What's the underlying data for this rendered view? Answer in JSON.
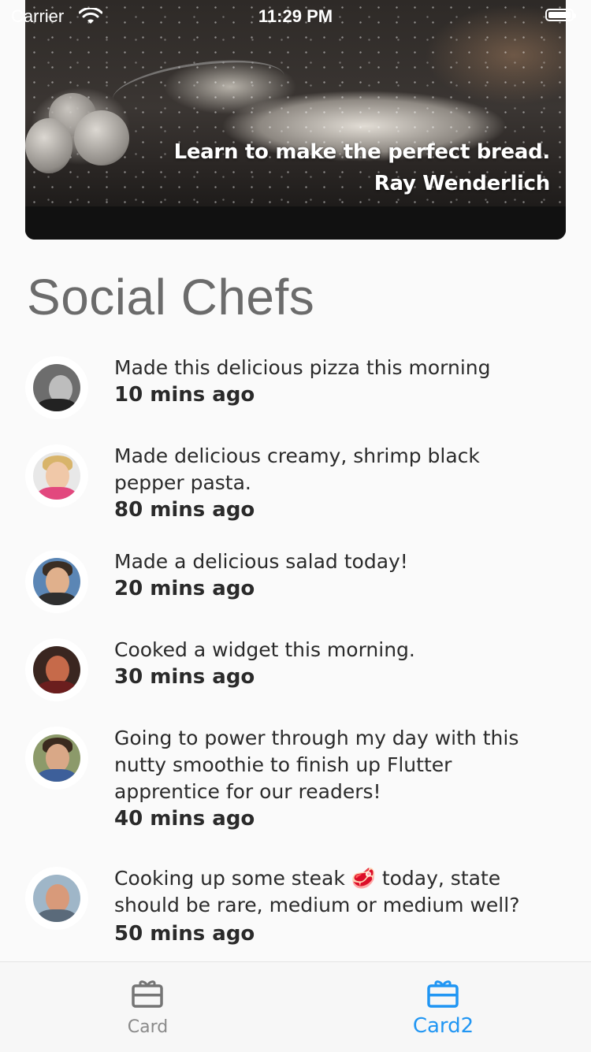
{
  "status_bar": {
    "carrier": "Carrier",
    "time": "11:29 PM"
  },
  "hero": {
    "title": "Learn to make the perfect bread.",
    "author": "Ray Wenderlich"
  },
  "section": {
    "title": "Social Chefs"
  },
  "feed": [
    {
      "text": "Made this delicious pizza this morning",
      "time": "10 mins ago"
    },
    {
      "text": "Made delicious creamy, shrimp black pepper pasta.",
      "time": "80 mins ago"
    },
    {
      "text": "Made a delicious salad today!",
      "time": "20 mins ago"
    },
    {
      "text": "Cooked a widget this morning.",
      "time": "30 mins ago"
    },
    {
      "text": "Going to power through my day with this nutty smoothie to finish up Flutter apprentice for our readers!",
      "time": "40 mins ago"
    },
    {
      "text": "Cooking up some steak 🥩 today, state should be rare, medium or medium well?",
      "time": "50 mins ago"
    }
  ],
  "tabs": [
    {
      "label": "Card",
      "selected": false,
      "icon": "card-giftcard-icon"
    },
    {
      "label": "Card2",
      "selected": true,
      "icon": "card-giftcard-icon"
    }
  ],
  "colors": {
    "accent": "#2196f3",
    "inactive_tab": "#8a8a8a",
    "background": "#fafafa"
  }
}
